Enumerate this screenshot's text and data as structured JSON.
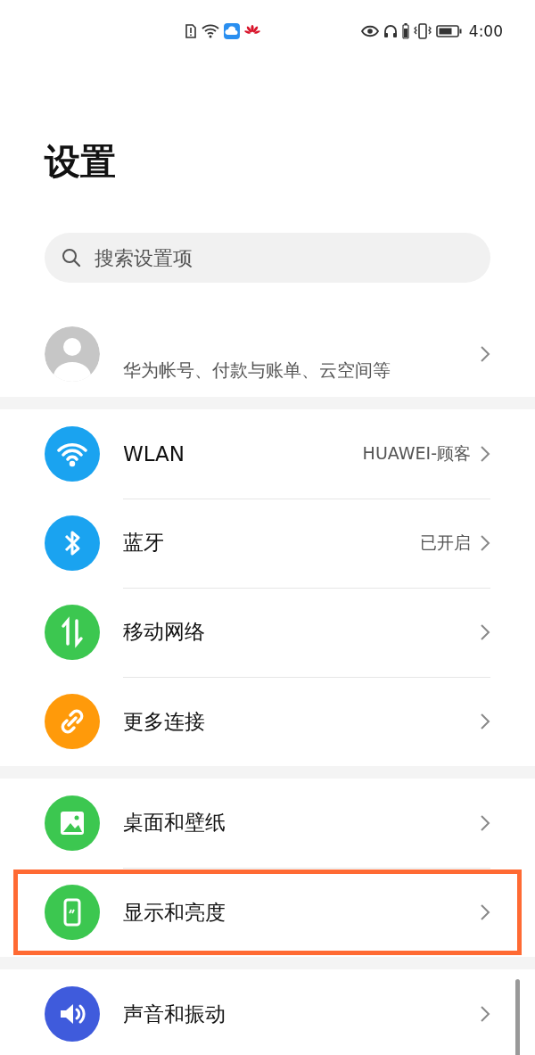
{
  "status_bar": {
    "time": "4:00"
  },
  "title": "设置",
  "search": {
    "placeholder": "搜索设置项"
  },
  "account": {
    "subtitle": "华为帐号、付款与账单、云空间等"
  },
  "groups": [
    {
      "items": [
        {
          "kind": "wifi",
          "label": "WLAN",
          "value": "HUAWEI-顾客",
          "color": "#1aa3f0",
          "highlighted": false
        },
        {
          "kind": "bluetooth",
          "label": "蓝牙",
          "value": "已开启",
          "color": "#1aa3f0",
          "highlighted": false
        },
        {
          "kind": "mobile",
          "label": "移动网络",
          "color": "#3cc750",
          "highlighted": false
        },
        {
          "kind": "link",
          "label": "更多连接",
          "color": "#ff9a0a",
          "highlighted": false
        }
      ]
    },
    {
      "items": [
        {
          "kind": "wallpaper",
          "label": "桌面和壁纸",
          "color": "#3cc750",
          "highlighted": false
        },
        {
          "kind": "display",
          "label": "显示和亮度",
          "color": "#3cc750",
          "highlighted": true
        }
      ]
    },
    {
      "items": [
        {
          "kind": "sound",
          "label": "声音和振动",
          "color": "#3f5bdc",
          "highlighted": false
        }
      ]
    }
  ]
}
